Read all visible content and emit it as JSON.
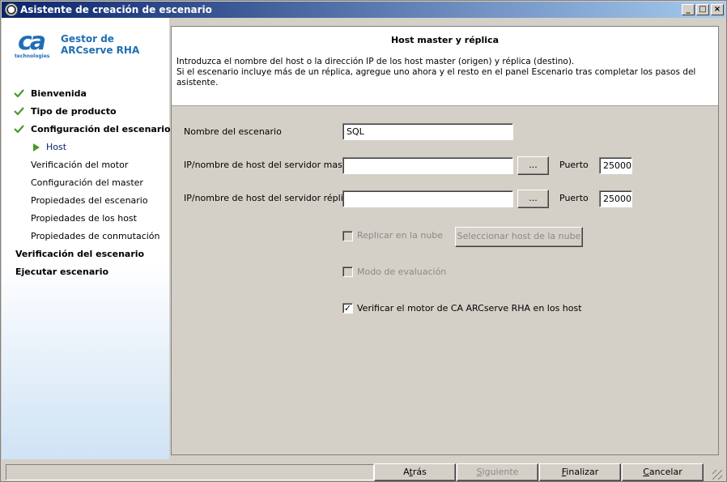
{
  "window": {
    "title": "Asistente de creación de escenario"
  },
  "sidebar": {
    "logo_text": "ca",
    "logo_subtext": "technologies",
    "product_line1": "Gestor de",
    "product_line2": "ARCserve RHA",
    "steps": [
      {
        "label": "Bienvenida",
        "state": "done"
      },
      {
        "label": "Tipo de producto",
        "state": "done"
      },
      {
        "label": "Configuración del escenario",
        "state": "done"
      },
      {
        "label": "Host",
        "state": "current"
      },
      {
        "label": "Verificación del motor",
        "state": "sub"
      },
      {
        "label": "Configuración del master",
        "state": "sub"
      },
      {
        "label": "Propiedades del escenario",
        "state": "sub"
      },
      {
        "label": "Propiedades de los host",
        "state": "sub"
      },
      {
        "label": "Propiedades de conmutación",
        "state": "sub"
      },
      {
        "label": "Verificación del escenario",
        "state": "main"
      },
      {
        "label": "Ejecutar escenario",
        "state": "main"
      }
    ]
  },
  "header": {
    "title": "Host master y réplica",
    "desc_line1": "Introduzca el nombre del host o la dirección IP de los host master (origen) y réplica (destino).",
    "desc_line2": "Si el escenario incluye más de un réplica, agregue uno ahora y el resto en el panel Escenario tras completar los pasos del asistente."
  },
  "form": {
    "scenario_name_label": "Nombre del escenario",
    "scenario_name_value": "SQL",
    "master_label": "IP/nombre de host del servidor master",
    "master_value": "",
    "master_browse": "...",
    "master_port_label": "Puerto",
    "master_port_value": "25000",
    "replica_label": "IP/nombre de host del servidor réplica",
    "replica_value": "",
    "replica_browse": "...",
    "replica_port_label": "Puerto",
    "replica_port_value": "25000",
    "cloud_label": "Replicar en la nube",
    "cloud_checked": false,
    "cloud_button": "Seleccionar host de la nube",
    "eval_label": "Modo de evaluación",
    "eval_checked": false,
    "verify_label": "Verificar el motor de CA ARCserve RHA en los host",
    "verify_checked": true
  },
  "footer": {
    "back": "Atrás",
    "next": "Siguiente",
    "finish": "Finalizar",
    "cancel": "Cancelar",
    "back_key": "t",
    "next_key": "S",
    "finish_key": "F",
    "cancel_key": "C"
  },
  "colors": {
    "title_gradient_start": "#0a246a",
    "brand_blue": "#1f6eb4",
    "check_green": "#4a9a2a"
  }
}
